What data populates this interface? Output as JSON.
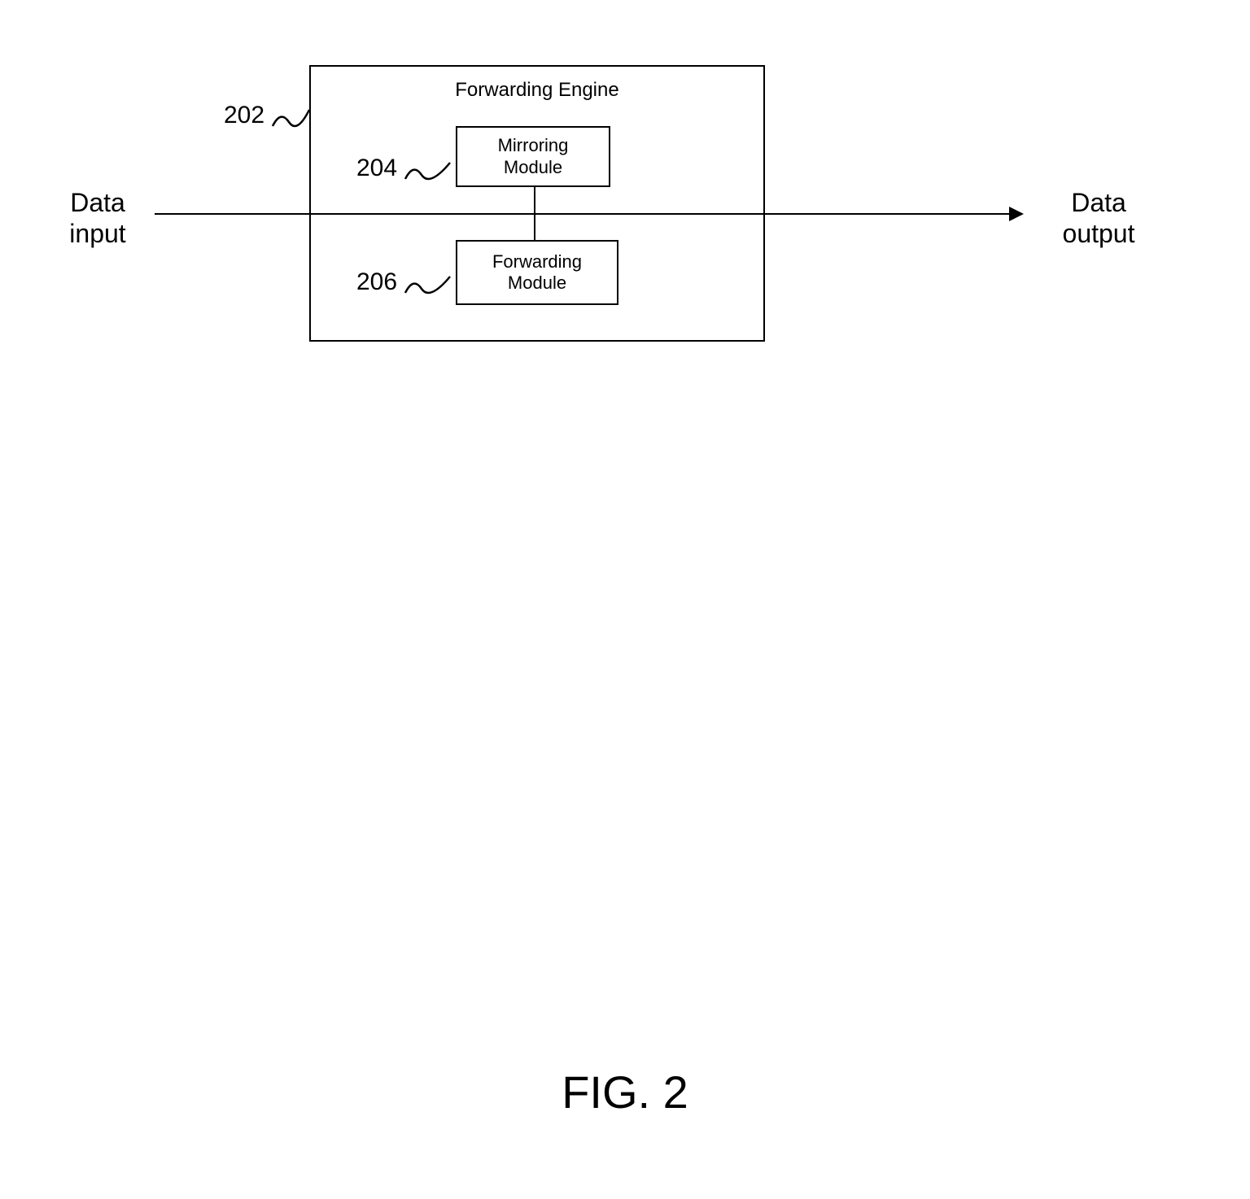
{
  "diagram": {
    "engine_title": "Forwarding Engine",
    "mirror_module_line1": "Mirroring",
    "mirror_module_line2": "Module",
    "forward_module_line1": "Forwarding",
    "forward_module_line2": "Module",
    "input_label_line1": "Data",
    "input_label_line2": "input",
    "output_label_line1": "Data",
    "output_label_line2": "output",
    "ref_202": "202",
    "ref_204": "204",
    "ref_206": "206"
  },
  "caption": "FIG. 2"
}
